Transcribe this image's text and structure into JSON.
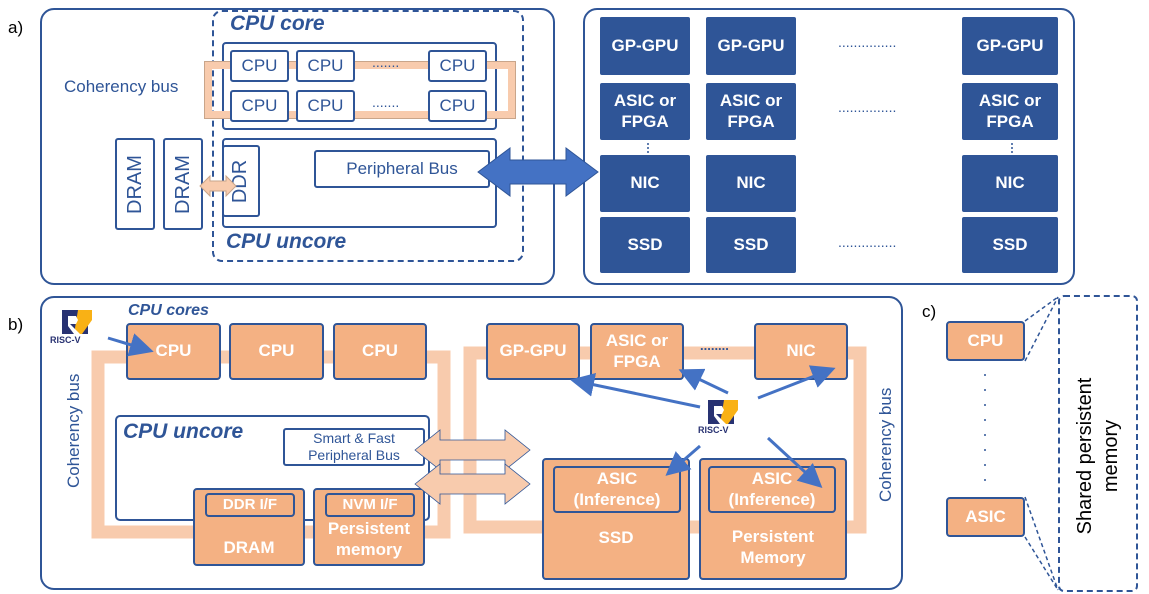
{
  "panel_labels": {
    "a": "a)",
    "b": "b)",
    "c": "c)"
  },
  "panel_a": {
    "cpu_core_title": "CPU core",
    "cpu_uncore_title": "CPU uncore",
    "coherency_bus": "Coherency bus",
    "cpu": "CPU",
    "dots": ".......",
    "dram": "DRAM",
    "ddr": "DDR",
    "peripheral_bus": "Peripheral Bus",
    "accelerators": {
      "gpgpu": "GP-GPU",
      "asic_fpga": "ASIC or FPGA",
      "nic": "NIC",
      "ssd": "SSD",
      "dots": "..............."
    }
  },
  "panel_b": {
    "logo_text": "RISC-V",
    "cpu_cores_title": "CPU cores",
    "cpu": "CPU",
    "cpu_uncore_title": "CPU uncore",
    "smart_bus": "Smart & Fast Peripheral Bus",
    "ddr_if": "DDR I/F",
    "dram": "DRAM",
    "nvm_if": "NVM I/F",
    "persistent_memory": "Persistent memory",
    "coherency_bus": "Coherency bus",
    "gpgpu": "GP-GPU",
    "asic_fpga": "ASIC or FPGA",
    "nic": "NIC",
    "dots": "........",
    "asic_inference": "ASIC (Inference)",
    "ssd": "SSD",
    "persistent_memory_2": "Persistent Memory"
  },
  "panel_c": {
    "cpu": "CPU",
    "asic": "ASIC",
    "shared_memory": "Shared persistent memory"
  },
  "colors": {
    "blue": "#2f5597",
    "orange": "#f4b183",
    "light_orange": "#f8cbad",
    "arrow_blue": "#4472c4"
  }
}
